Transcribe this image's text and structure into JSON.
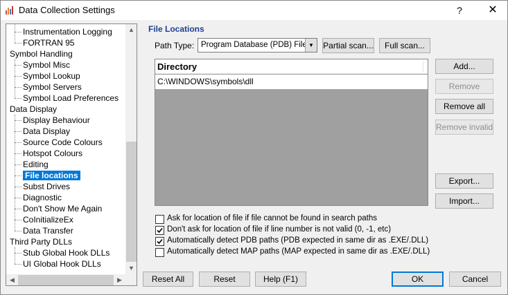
{
  "window": {
    "title": "Data Collection Settings",
    "help_glyph": "?",
    "close_glyph": "✕"
  },
  "tree": {
    "items": [
      {
        "label": "Instrumentation Logging",
        "level": 1
      },
      {
        "label": "FORTRAN 95",
        "level": 1
      },
      {
        "label": "Symbol Handling",
        "level": 0
      },
      {
        "label": "Symbol Misc",
        "level": 1
      },
      {
        "label": "Symbol Lookup",
        "level": 1
      },
      {
        "label": "Symbol Servers",
        "level": 1
      },
      {
        "label": "Symbol Load Preferences",
        "level": 1
      },
      {
        "label": "Data Display",
        "level": 0
      },
      {
        "label": "Display Behaviour",
        "level": 1
      },
      {
        "label": "Data Display",
        "level": 1
      },
      {
        "label": "Source Code Colours",
        "level": 1
      },
      {
        "label": "Hotspot Colours",
        "level": 1
      },
      {
        "label": "Editing",
        "level": 1
      },
      {
        "label": "File locations",
        "level": 1,
        "selected": true
      },
      {
        "label": "Subst Drives",
        "level": 1
      },
      {
        "label": "Diagnostic",
        "level": 1
      },
      {
        "label": "Don't Show Me Again",
        "level": 1
      },
      {
        "label": "CoInitializeEx",
        "level": 1
      },
      {
        "label": "Data Transfer",
        "level": 1
      },
      {
        "label": "Third Party DLLs",
        "level": 0
      },
      {
        "label": "Stub Global Hook DLLs",
        "level": 1
      },
      {
        "label": "UI Global Hook DLLs",
        "level": 1
      }
    ]
  },
  "panel": {
    "title": "File Locations",
    "path_type_label": "Path Type:",
    "path_type_value": "Program Database (PDB) Files",
    "partial_scan": "Partial scan...",
    "full_scan": "Full scan...",
    "list_header": "Directory",
    "list_rows": [
      "C:\\WINDOWS\\symbols\\dll"
    ],
    "add": "Add...",
    "remove": "Remove",
    "remove_all": "Remove all",
    "remove_invalid": "Remove invalid",
    "export": "Export...",
    "import": "Import...",
    "checkboxes": [
      {
        "label": "Ask for location of file if file cannot be found in search paths",
        "checked": false
      },
      {
        "label": "Don't ask for location of file if line number is not valid (0, -1, etc)",
        "checked": true
      },
      {
        "label": "Automatically detect PDB paths (PDB expected in same dir as .EXE/.DLL)",
        "checked": true
      },
      {
        "label": "Automatically detect MAP paths (MAP expected in same dir as .EXE/.DLL)",
        "checked": false
      }
    ]
  },
  "footer": {
    "reset_all": "Reset All",
    "reset": "Reset",
    "help": "Help (F1)",
    "ok": "OK",
    "cancel": "Cancel"
  },
  "colors": {
    "accent": "#0078d7",
    "section_title": "#1c3f94",
    "list_background": "#a0a0a0"
  }
}
